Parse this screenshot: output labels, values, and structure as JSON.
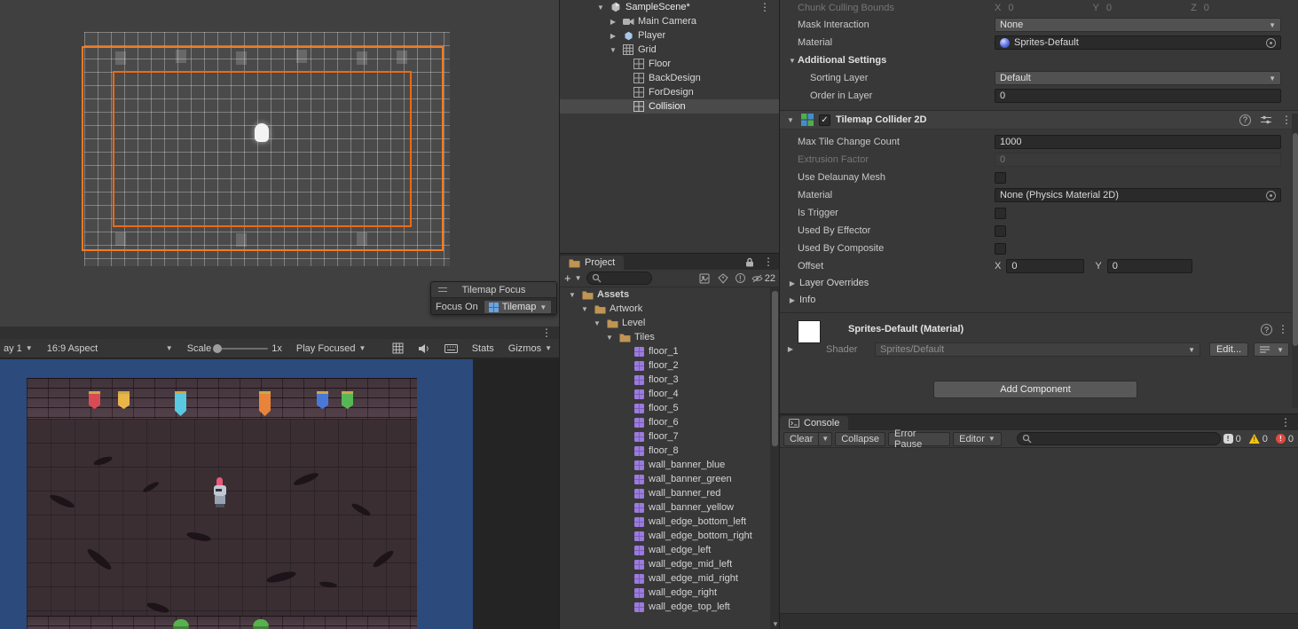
{
  "ui_colors": {
    "accent_orange": "#f47b20",
    "camera_background_blue": "#2c4a7c",
    "selection_gray": "#4a4a4a",
    "banner_red": "#d84a54",
    "banner_yellow": "#e8b54a",
    "banner_cyan": "#5ac8e0",
    "banner_orange": "#e8833a",
    "banner_blue": "#4a78d8",
    "banner_green": "#55b855"
  },
  "scene_view": {
    "overlay_title": "Tilemap Focus",
    "focus_on_label": "Focus On",
    "focus_value": "Tilemap"
  },
  "game_toolbar": {
    "display": "ay 1",
    "aspect": "16:9 Aspect",
    "scale_label": "Scale",
    "scale_value": "1x",
    "play_focused": "Play Focused",
    "stats": "Stats",
    "gizmos": "Gizmos"
  },
  "hierarchy": {
    "items": [
      {
        "label": "SampleScene*"
      },
      {
        "label": "Main Camera"
      },
      {
        "label": "Player"
      },
      {
        "label": "Grid"
      },
      {
        "label": "Floor"
      },
      {
        "label": "BackDesign"
      },
      {
        "label": "ForDesign"
      },
      {
        "label": "Collision"
      }
    ]
  },
  "project": {
    "tab": "Project",
    "hidden_count": "22",
    "search_value": "",
    "tree": [
      {
        "label": "Assets"
      },
      {
        "label": "Artwork"
      },
      {
        "label": "Level"
      },
      {
        "label": "Tiles"
      },
      {
        "label": "floor_1"
      },
      {
        "label": "floor_2"
      },
      {
        "label": "floor_3"
      },
      {
        "label": "floor_4"
      },
      {
        "label": "floor_5"
      },
      {
        "label": "floor_6"
      },
      {
        "label": "floor_7"
      },
      {
        "label": "floor_8"
      },
      {
        "label": "wall_banner_blue"
      },
      {
        "label": "wall_banner_green"
      },
      {
        "label": "wall_banner_red"
      },
      {
        "label": "wall_banner_yellow"
      },
      {
        "label": "wall_edge_bottom_left"
      },
      {
        "label": "wall_edge_bottom_right"
      },
      {
        "label": "wall_edge_left"
      },
      {
        "label": "wall_edge_mid_left"
      },
      {
        "label": "wall_edge_mid_right"
      },
      {
        "label": "wall_edge_right"
      },
      {
        "label": "wall_edge_top_left"
      }
    ]
  },
  "inspector": {
    "chunk_culling": {
      "label": "Chunk Culling Bounds",
      "x_label": "X",
      "x": "0",
      "y_label": "Y",
      "y": "0",
      "z_label": "Z",
      "z": "0"
    },
    "mask_interaction": {
      "label": "Mask Interaction",
      "value": "None"
    },
    "material": {
      "label": "Material",
      "value": "Sprites-Default"
    },
    "additional_settings": {
      "label": "Additional Settings"
    },
    "sorting_layer": {
      "label": "Sorting Layer",
      "value": "Default"
    },
    "order_in_layer": {
      "label": "Order in Layer",
      "value": "0"
    },
    "collider": {
      "title": "Tilemap Collider 2D",
      "max_tile_change": {
        "label": "Max Tile Change Count",
        "value": "1000"
      },
      "extrusion_factor": {
        "label": "Extrusion Factor",
        "value": "0"
      },
      "use_delaunay": {
        "label": "Use Delaunay Mesh"
      },
      "material": {
        "label": "Material",
        "value": "None (Physics Material 2D)"
      },
      "is_trigger": {
        "label": "Is Trigger"
      },
      "used_by_effector": {
        "label": "Used By Effector"
      },
      "used_by_composite": {
        "label": "Used By Composite"
      },
      "offset": {
        "label": "Offset",
        "x_label": "X",
        "x": "0",
        "y_label": "Y",
        "y": "0"
      },
      "layer_overrides": {
        "label": "Layer Overrides"
      },
      "info": {
        "label": "Info"
      }
    },
    "material_block": {
      "title": "Sprites-Default (Material)",
      "shader_label": "Shader",
      "shader_value": "Sprites/Default",
      "edit_button": "Edit..."
    },
    "add_component": "Add Component"
  },
  "console": {
    "tab": "Console",
    "clear": "Clear",
    "collapse": "Collapse",
    "error_pause": "Error Pause",
    "editor": "Editor",
    "search_value": "",
    "info_count": "0",
    "warning_count": "0",
    "error_count": "0"
  }
}
